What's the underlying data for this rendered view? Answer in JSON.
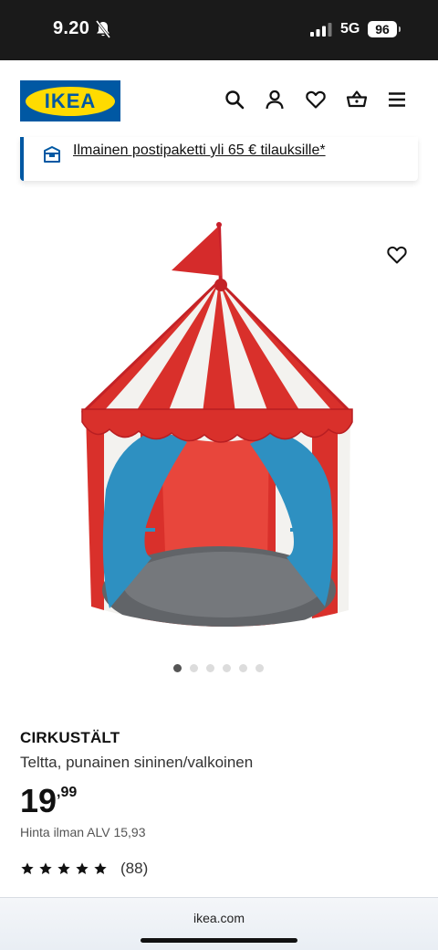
{
  "status_bar": {
    "time": "9.20",
    "network": "5G",
    "battery": "96",
    "icons": [
      "bell-muted-icon",
      "signal-icon"
    ]
  },
  "header": {
    "logo_text": "IKEA",
    "icons": [
      "search-icon",
      "account-icon",
      "heart-icon",
      "basket-icon",
      "menu-icon"
    ],
    "brand_colors": {
      "blue": "#0058a3",
      "yellow": "#ffdb00"
    }
  },
  "promo": {
    "icon": "parcel-icon",
    "text": "Ilmainen postipaketti yli 65 € tilauksille*"
  },
  "gallery": {
    "image_count": 6,
    "active_index": 0,
    "image_subject": "red, white and blue circus play tent"
  },
  "product": {
    "name": "CIRKUSTÄLT",
    "description": "Teltta, punainen sininen/valkoinen",
    "price_integer": "19",
    "price_decimal": ",99",
    "vat_text": "Hinta ilman ALV 15,93",
    "rating_stars": 5,
    "rating_count": "(88)"
  },
  "browser": {
    "url": "ikea.com"
  }
}
